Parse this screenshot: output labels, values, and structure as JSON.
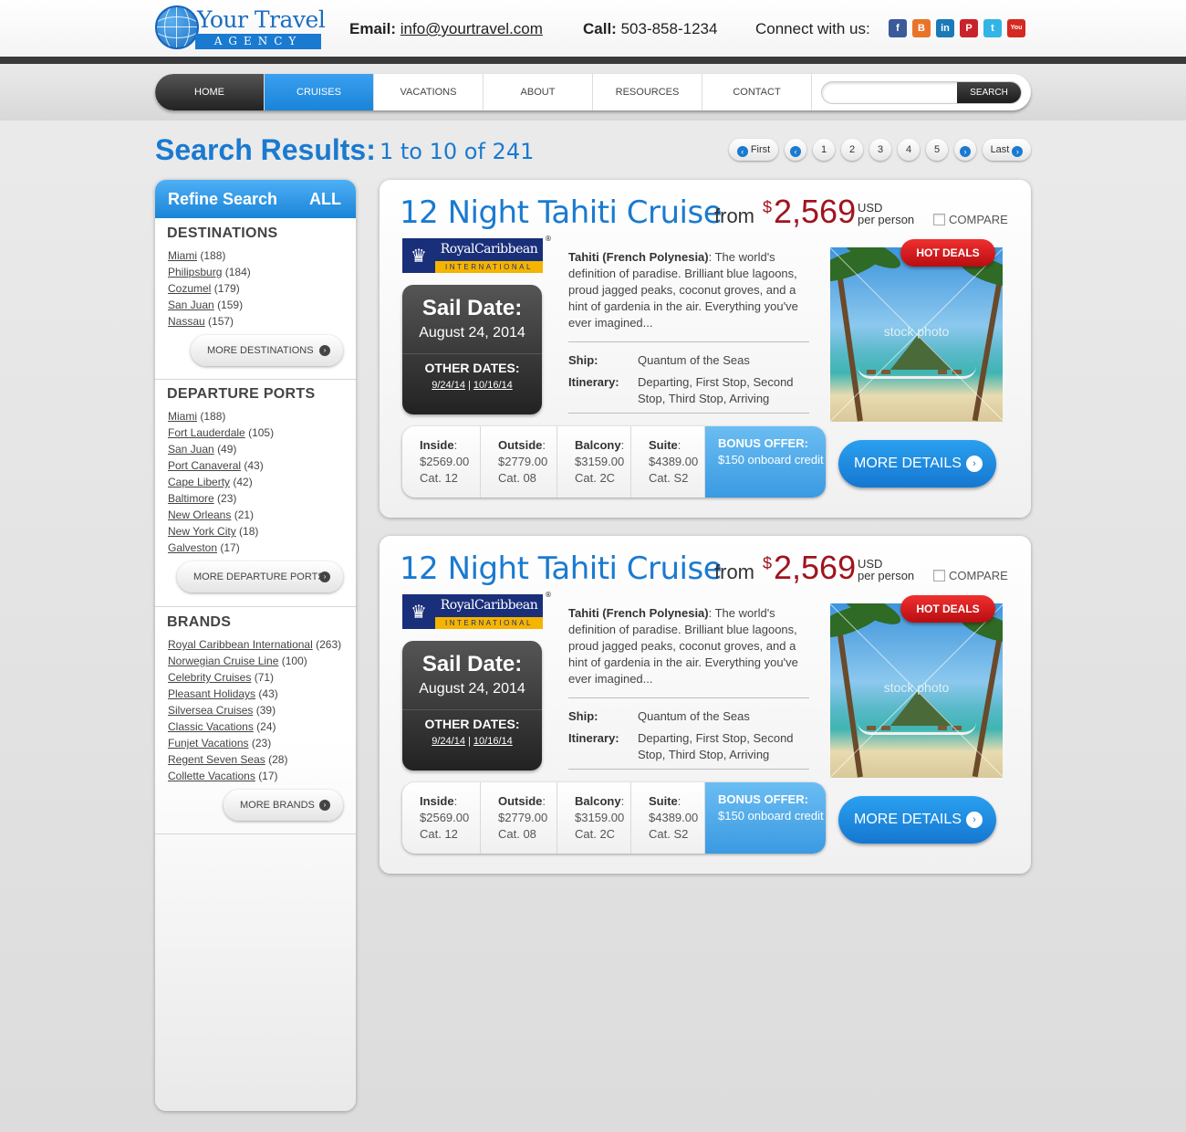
{
  "header": {
    "logo_name": "Your Travel",
    "logo_sub": "AGENCY",
    "email_label": "Email:",
    "email": "info@yourtravel.com",
    "call_label": "Call:",
    "phone": "503-858-1234",
    "connect_label": "Connect with us:",
    "social": [
      {
        "icon": "facebook-icon",
        "glyph": "f",
        "color": "#3b5a9a"
      },
      {
        "icon": "blog-icon",
        "glyph": "B",
        "color": "#e8742a"
      },
      {
        "icon": "linkedin-icon",
        "glyph": "in",
        "color": "#1a7ab8"
      },
      {
        "icon": "pinterest-icon",
        "glyph": "P",
        "color": "#c8232c"
      },
      {
        "icon": "twitter-icon",
        "glyph": "t",
        "color": "#33b4e6"
      },
      {
        "icon": "youtube-icon",
        "glyph": "You",
        "color": "#d42a22"
      }
    ]
  },
  "nav": {
    "items": [
      "HOME",
      "CRUISES",
      "VACATIONS",
      "ABOUT",
      "RESOURCES",
      "CONTACT"
    ],
    "active": "CRUISES",
    "search_placeholder": "",
    "search_button": "SEARCH"
  },
  "results": {
    "title": "Search Results:",
    "count": "1 to 10 of 241",
    "pager": {
      "first": "First",
      "pages": [
        "1",
        "2",
        "3",
        "4",
        "5"
      ],
      "last": "Last"
    }
  },
  "sidebar": {
    "title": "Refine Search",
    "all": "ALL",
    "destinations": {
      "title": "DESTINATIONS",
      "items": [
        {
          "name": "Miami",
          "count": "(188)"
        },
        {
          "name": "Philipsburg",
          "count": "(184)"
        },
        {
          "name": "Cozumel",
          "count": "(179)"
        },
        {
          "name": "San Juan",
          "count": "(159)"
        },
        {
          "name": "Nassau",
          "count": "(157)"
        }
      ],
      "more": "MORE DESTINATIONS"
    },
    "ports": {
      "title": "DEPARTURE PORTS",
      "items": [
        {
          "name": "Miami",
          "count": "(188)"
        },
        {
          "name": "Fort Lauderdale",
          "count": "(105)"
        },
        {
          "name": "San Juan",
          "count": "(49)"
        },
        {
          "name": "Port Canaveral",
          "count": "(43)"
        },
        {
          "name": "Cape Liberty",
          "count": "(42)"
        },
        {
          "name": "Baltimore",
          "count": "(23)"
        },
        {
          "name": "New Orleans",
          "count": "(21)"
        },
        {
          "name": "New York City",
          "count": "(18)"
        },
        {
          "name": "Galveston",
          "count": "(17)"
        }
      ],
      "more": "MORE DEPARTURE PORTS"
    },
    "brands": {
      "title": "BRANDS",
      "items": [
        {
          "name": "Royal Caribbean International",
          "count": "(263)"
        },
        {
          "name": "Norwegian Cruise Line",
          "count": "(100)"
        },
        {
          "name": "Celebrity Cruises",
          "count": "(71)"
        },
        {
          "name": "Pleasant Holidays",
          "count": "(43)"
        },
        {
          "name": "Silversea Cruises",
          "count": "(39)"
        },
        {
          "name": "Classic Vacations",
          "count": "(24)"
        },
        {
          "name": "Funjet Vacations",
          "count": "(23)"
        },
        {
          "name": "Regent Seven Seas",
          "count": "(28)"
        },
        {
          "name": "Collette Vacations",
          "count": "(17)"
        }
      ],
      "more": "MORE BRANDS"
    }
  },
  "cards": [
    {
      "title": "12 Night Tahiti Cruise",
      "from": "from",
      "currency_symbol": "$",
      "price": "2,569",
      "usd": "USD",
      "per_person": "per person",
      "compare": "COMPARE",
      "brand_name": "RoyalCaribbean",
      "brand_sub": "INTERNATIONAL",
      "sail_label": "Sail Date:",
      "sail_date": "August 24, 2014",
      "other_label": "OTHER DATES:",
      "other_dates": [
        "9/24/14",
        "10/16/14"
      ],
      "dest_bold": "Tahiti (French Polynesia)",
      "dest_text": ": The world's definition of paradise. Brilliant blue lagoons, proud jagged peaks, coconut groves, and a hint of gardenia in the air. Everything you've ever imagined...",
      "ship_label": "Ship:",
      "ship": "Quantum of the Seas",
      "itinerary_label": "Itinerary:",
      "itinerary": "Departing, First Stop, Second Stop, Third Stop, Arriving",
      "hot": "HOT DEALS",
      "watermark": "stock photo",
      "prices": [
        {
          "label": "Inside",
          "price": "$2569.00",
          "cat": "Cat. 12"
        },
        {
          "label": "Outside",
          "price": "$2779.00",
          "cat": "Cat. 08"
        },
        {
          "label": "Balcony",
          "price": "$3159.00",
          "cat": "Cat. 2C"
        },
        {
          "label": "Suite",
          "price": "$4389.00",
          "cat": "Cat. S2"
        }
      ],
      "bonus_label": "BONUS OFFER:",
      "bonus_text": "$150 onboard credit",
      "details": "MORE DETAILS"
    },
    {
      "title": "12 Night Tahiti Cruise",
      "from": "from",
      "currency_symbol": "$",
      "price": "2,569",
      "usd": "USD",
      "per_person": "per person",
      "compare": "COMPARE",
      "brand_name": "RoyalCaribbean",
      "brand_sub": "INTERNATIONAL",
      "sail_label": "Sail Date:",
      "sail_date": "August 24, 2014",
      "other_label": "OTHER DATES:",
      "other_dates": [
        "9/24/14",
        "10/16/14"
      ],
      "dest_bold": "Tahiti (French Polynesia)",
      "dest_text": ": The world's definition of paradise. Brilliant blue lagoons, proud jagged peaks, coconut groves, and a hint of gardenia in the air. Everything you've ever imagined...",
      "ship_label": "Ship:",
      "ship": "Quantum of the Seas",
      "itinerary_label": "Itinerary:",
      "itinerary": "Departing, First Stop, Second Stop, Third Stop, Arriving",
      "hot": "HOT DEALS",
      "watermark": "stock photo",
      "prices": [
        {
          "label": "Inside",
          "price": "$2569.00",
          "cat": "Cat. 12"
        },
        {
          "label": "Outside",
          "price": "$2779.00",
          "cat": "Cat. 08"
        },
        {
          "label": "Balcony",
          "price": "$3159.00",
          "cat": "Cat. 2C"
        },
        {
          "label": "Suite",
          "price": "$4389.00",
          "cat": "Cat. S2"
        }
      ],
      "bonus_label": "BONUS OFFER:",
      "bonus_text": "$150 onboard credit",
      "details": "MORE DETAILS"
    }
  ]
}
